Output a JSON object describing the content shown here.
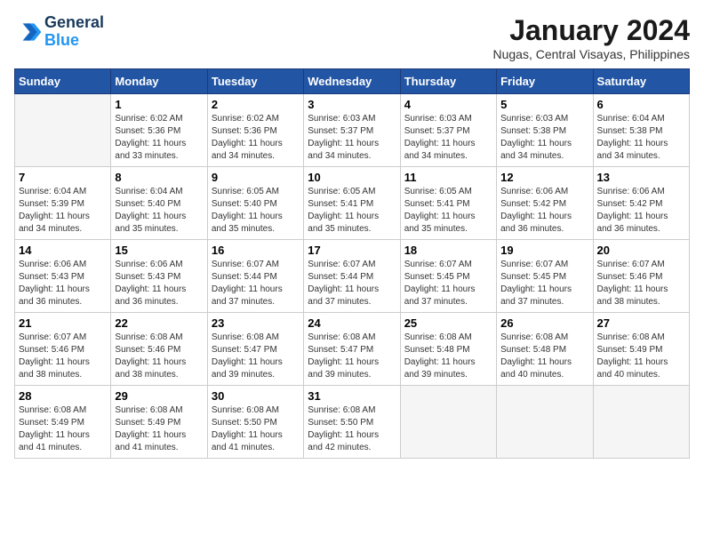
{
  "logo": {
    "line1": "General",
    "line2": "Blue"
  },
  "title": "January 2024",
  "subtitle": "Nugas, Central Visayas, Philippines",
  "days_of_week": [
    "Sunday",
    "Monday",
    "Tuesday",
    "Wednesday",
    "Thursday",
    "Friday",
    "Saturday"
  ],
  "weeks": [
    [
      {
        "day": "",
        "detail": ""
      },
      {
        "day": "1",
        "detail": "Sunrise: 6:02 AM\nSunset: 5:36 PM\nDaylight: 11 hours\nand 33 minutes."
      },
      {
        "day": "2",
        "detail": "Sunrise: 6:02 AM\nSunset: 5:36 PM\nDaylight: 11 hours\nand 34 minutes."
      },
      {
        "day": "3",
        "detail": "Sunrise: 6:03 AM\nSunset: 5:37 PM\nDaylight: 11 hours\nand 34 minutes."
      },
      {
        "day": "4",
        "detail": "Sunrise: 6:03 AM\nSunset: 5:37 PM\nDaylight: 11 hours\nand 34 minutes."
      },
      {
        "day": "5",
        "detail": "Sunrise: 6:03 AM\nSunset: 5:38 PM\nDaylight: 11 hours\nand 34 minutes."
      },
      {
        "day": "6",
        "detail": "Sunrise: 6:04 AM\nSunset: 5:38 PM\nDaylight: 11 hours\nand 34 minutes."
      }
    ],
    [
      {
        "day": "7",
        "detail": "Sunrise: 6:04 AM\nSunset: 5:39 PM\nDaylight: 11 hours\nand 34 minutes."
      },
      {
        "day": "8",
        "detail": "Sunrise: 6:04 AM\nSunset: 5:40 PM\nDaylight: 11 hours\nand 35 minutes."
      },
      {
        "day": "9",
        "detail": "Sunrise: 6:05 AM\nSunset: 5:40 PM\nDaylight: 11 hours\nand 35 minutes."
      },
      {
        "day": "10",
        "detail": "Sunrise: 6:05 AM\nSunset: 5:41 PM\nDaylight: 11 hours\nand 35 minutes."
      },
      {
        "day": "11",
        "detail": "Sunrise: 6:05 AM\nSunset: 5:41 PM\nDaylight: 11 hours\nand 35 minutes."
      },
      {
        "day": "12",
        "detail": "Sunrise: 6:06 AM\nSunset: 5:42 PM\nDaylight: 11 hours\nand 36 minutes."
      },
      {
        "day": "13",
        "detail": "Sunrise: 6:06 AM\nSunset: 5:42 PM\nDaylight: 11 hours\nand 36 minutes."
      }
    ],
    [
      {
        "day": "14",
        "detail": "Sunrise: 6:06 AM\nSunset: 5:43 PM\nDaylight: 11 hours\nand 36 minutes."
      },
      {
        "day": "15",
        "detail": "Sunrise: 6:06 AM\nSunset: 5:43 PM\nDaylight: 11 hours\nand 36 minutes."
      },
      {
        "day": "16",
        "detail": "Sunrise: 6:07 AM\nSunset: 5:44 PM\nDaylight: 11 hours\nand 37 minutes."
      },
      {
        "day": "17",
        "detail": "Sunrise: 6:07 AM\nSunset: 5:44 PM\nDaylight: 11 hours\nand 37 minutes."
      },
      {
        "day": "18",
        "detail": "Sunrise: 6:07 AM\nSunset: 5:45 PM\nDaylight: 11 hours\nand 37 minutes."
      },
      {
        "day": "19",
        "detail": "Sunrise: 6:07 AM\nSunset: 5:45 PM\nDaylight: 11 hours\nand 37 minutes."
      },
      {
        "day": "20",
        "detail": "Sunrise: 6:07 AM\nSunset: 5:46 PM\nDaylight: 11 hours\nand 38 minutes."
      }
    ],
    [
      {
        "day": "21",
        "detail": "Sunrise: 6:07 AM\nSunset: 5:46 PM\nDaylight: 11 hours\nand 38 minutes."
      },
      {
        "day": "22",
        "detail": "Sunrise: 6:08 AM\nSunset: 5:46 PM\nDaylight: 11 hours\nand 38 minutes."
      },
      {
        "day": "23",
        "detail": "Sunrise: 6:08 AM\nSunset: 5:47 PM\nDaylight: 11 hours\nand 39 minutes."
      },
      {
        "day": "24",
        "detail": "Sunrise: 6:08 AM\nSunset: 5:47 PM\nDaylight: 11 hours\nand 39 minutes."
      },
      {
        "day": "25",
        "detail": "Sunrise: 6:08 AM\nSunset: 5:48 PM\nDaylight: 11 hours\nand 39 minutes."
      },
      {
        "day": "26",
        "detail": "Sunrise: 6:08 AM\nSunset: 5:48 PM\nDaylight: 11 hours\nand 40 minutes."
      },
      {
        "day": "27",
        "detail": "Sunrise: 6:08 AM\nSunset: 5:49 PM\nDaylight: 11 hours\nand 40 minutes."
      }
    ],
    [
      {
        "day": "28",
        "detail": "Sunrise: 6:08 AM\nSunset: 5:49 PM\nDaylight: 11 hours\nand 41 minutes."
      },
      {
        "day": "29",
        "detail": "Sunrise: 6:08 AM\nSunset: 5:49 PM\nDaylight: 11 hours\nand 41 minutes."
      },
      {
        "day": "30",
        "detail": "Sunrise: 6:08 AM\nSunset: 5:50 PM\nDaylight: 11 hours\nand 41 minutes."
      },
      {
        "day": "31",
        "detail": "Sunrise: 6:08 AM\nSunset: 5:50 PM\nDaylight: 11 hours\nand 42 minutes."
      },
      {
        "day": "",
        "detail": ""
      },
      {
        "day": "",
        "detail": ""
      },
      {
        "day": "",
        "detail": ""
      }
    ]
  ]
}
